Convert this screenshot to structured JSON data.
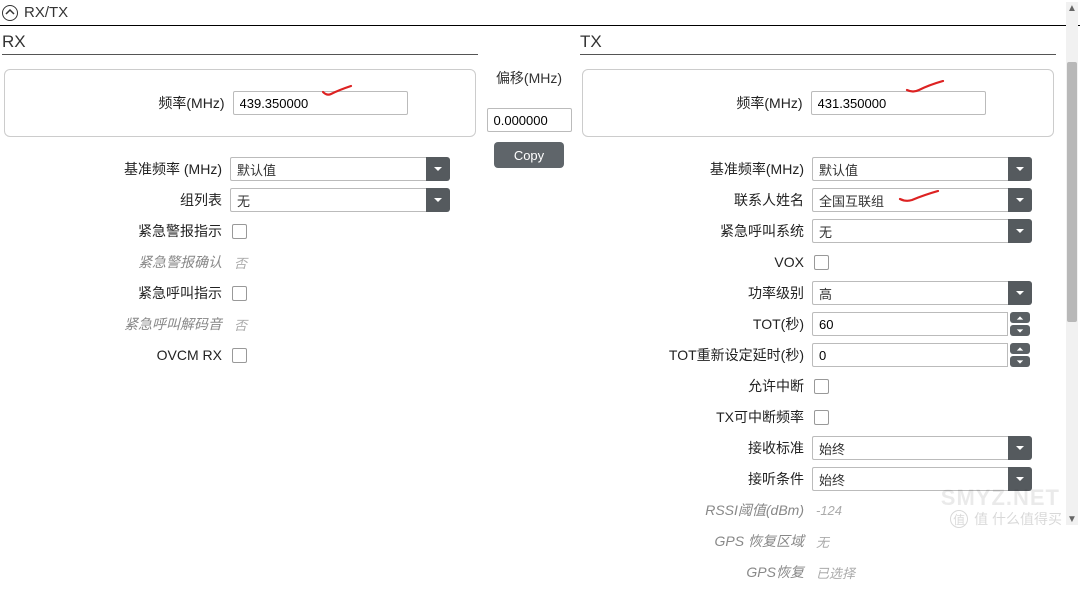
{
  "section_title": "RX/TX",
  "rx": {
    "title": "RX",
    "freq_label": "频率(MHz)",
    "freq_value": "439.350000",
    "fields": {
      "ref_freq_label": "基准频率 (MHz)",
      "ref_freq_value": "默认值",
      "group_list_label": "组列表",
      "group_list_value": "无",
      "emergency_alarm_label": "紧急警报指示",
      "emergency_ack_label": "紧急警报确认",
      "emergency_ack_value": "否",
      "emergency_call_label": "紧急呼叫指示",
      "emergency_decode_label": "紧急呼叫解码音",
      "emergency_decode_value": "否",
      "ovcm_label": "OVCM RX"
    }
  },
  "mid": {
    "offset_label": "偏移(MHz)",
    "offset_value": "0.000000",
    "copy_label": "Copy"
  },
  "tx": {
    "title": "TX",
    "freq_label": "频率(MHz)",
    "freq_value": "431.350000",
    "fields": {
      "ref_freq_label": "基准频率(MHz)",
      "ref_freq_value": "默认值",
      "contact_label": "联系人姓名",
      "contact_value": "全国互联组",
      "emergency_sys_label": "紧急呼叫系统",
      "emergency_sys_value": "无",
      "vox_label": "VOX",
      "power_label": "功率级别",
      "power_value": "高",
      "tot_label": "TOT(秒)",
      "tot_value": "60",
      "tot_rekey_label": "TOT重新设定延时(秒)",
      "tot_rekey_value": "0",
      "allow_interrupt_label": "允许中断",
      "tx_interruptible_label": "TX可中断频率",
      "admit_label": "接收标准",
      "admit_value": "始终",
      "in_call_label": "接听条件",
      "in_call_value": "始终",
      "rssi_label": "RSSI阈值(dBm)",
      "rssi_value": "-124",
      "gps_zone_label": "GPS 恢复区域",
      "gps_zone_value": "无",
      "gps_revert_label": "GPS恢复",
      "gps_revert_value": "已选择"
    }
  },
  "watermarks": {
    "zdm": "值 什么值得买",
    "smyz": "SMYZ.NET"
  }
}
